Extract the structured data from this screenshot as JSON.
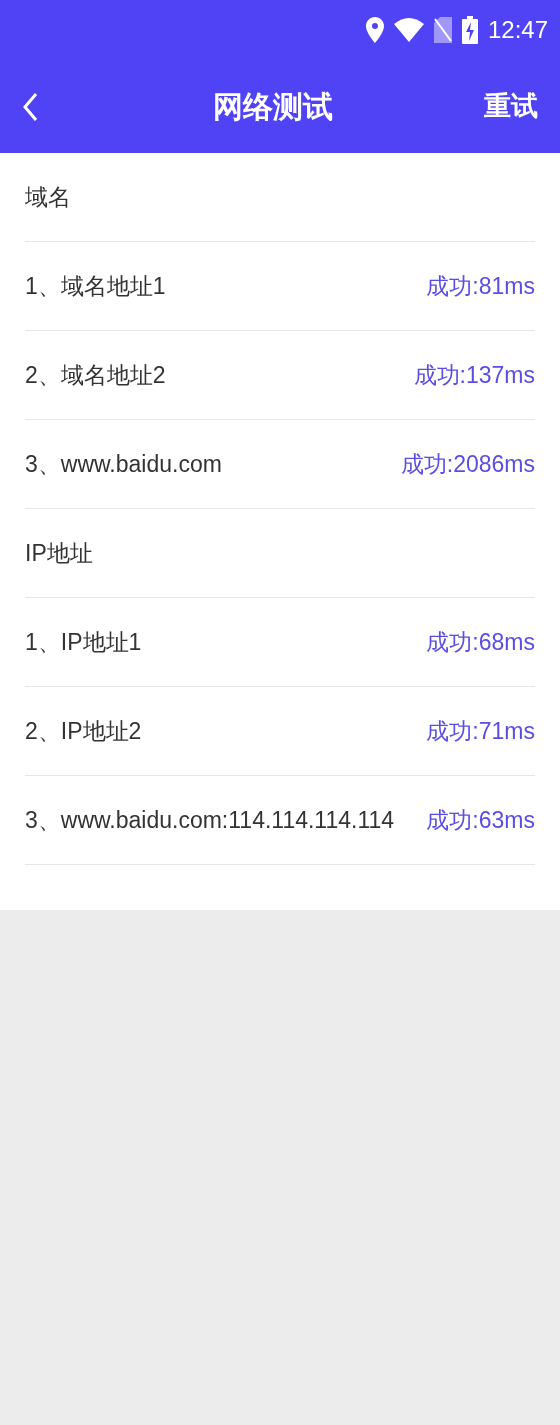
{
  "status_bar": {
    "time": "12:47"
  },
  "header": {
    "title": "网络测试",
    "action": "重试"
  },
  "sections": [
    {
      "title": "域名",
      "items": [
        {
          "label": "1、域名地址1",
          "result": "成功:81ms"
        },
        {
          "label": "2、域名地址2",
          "result": "成功:137ms"
        },
        {
          "label": "3、www.baidu.com",
          "result": "成功:2086ms"
        }
      ]
    },
    {
      "title": "IP地址",
      "items": [
        {
          "label": "1、IP地址1",
          "result": "成功:68ms"
        },
        {
          "label": "2、IP地址2",
          "result": "成功:71ms"
        },
        {
          "label": "3、www.baidu.com:114.114.114.114",
          "result": "成功:63ms"
        }
      ]
    }
  ]
}
